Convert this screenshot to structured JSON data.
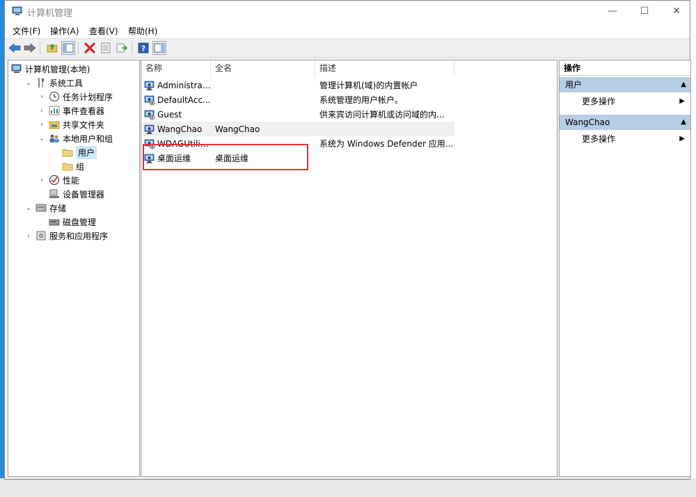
{
  "window": {
    "title": "计算机管理",
    "minimize": "—",
    "maximize": "☐",
    "close": "✕"
  },
  "menu": [
    {
      "label": "文件(F)"
    },
    {
      "label": "操作(A)"
    },
    {
      "label": "查看(V)"
    },
    {
      "label": "帮助(H)"
    }
  ],
  "toolbar": [
    {
      "icon": "back-arrow-icon"
    },
    {
      "icon": "forward-arrow-icon"
    },
    {
      "icon": "up-folder-icon"
    },
    {
      "icon": "show-hide-tree-icon"
    },
    {
      "icon": "delete-icon"
    },
    {
      "icon": "properties-icon"
    },
    {
      "icon": "export-list-icon"
    },
    {
      "icon": "help-icon"
    },
    {
      "icon": "show-hide-action-pane-icon"
    }
  ],
  "tree": [
    {
      "label": "计算机管理(本地)",
      "indent": 0,
      "chevron": "",
      "icon": "computer-icon"
    },
    {
      "label": "系统工具",
      "indent": 1,
      "chevron": "⌄",
      "icon": "tools-icon"
    },
    {
      "label": "任务计划程序",
      "indent": 2,
      "chevron": "›",
      "icon": "clock-icon"
    },
    {
      "label": "事件查看器",
      "indent": 2,
      "chevron": "›",
      "icon": "event-viewer-icon"
    },
    {
      "label": "共享文件夹",
      "indent": 2,
      "chevron": "›",
      "icon": "shared-folder-icon"
    },
    {
      "label": "本地用户和组",
      "indent": 2,
      "chevron": "⌄",
      "icon": "users-group-icon"
    },
    {
      "label": "用户",
      "indent": 3,
      "chevron": "",
      "icon": "folder-icon",
      "selected": true
    },
    {
      "label": "组",
      "indent": 3,
      "chevron": "",
      "icon": "folder-icon"
    },
    {
      "label": "性能",
      "indent": 2,
      "chevron": "›",
      "icon": "performance-icon"
    },
    {
      "label": "设备管理器",
      "indent": 2,
      "chevron": "",
      "icon": "device-manager-icon"
    },
    {
      "label": "存储",
      "indent": 1,
      "chevron": "⌄",
      "icon": "storage-icon"
    },
    {
      "label": "磁盘管理",
      "indent": 2,
      "chevron": "",
      "icon": "disk-icon"
    },
    {
      "label": "服务和应用程序",
      "indent": 1,
      "chevron": "›",
      "icon": "services-icon"
    }
  ],
  "columns": {
    "name": "名称",
    "fullname": "全名",
    "desc": "描述"
  },
  "users": [
    {
      "name": "Administrat...",
      "fullname": "",
      "desc": "管理计算机(域)的内置帐户"
    },
    {
      "name": "DefaultAcc...",
      "fullname": "",
      "desc": "系统管理的用户帐户。"
    },
    {
      "name": "Guest",
      "fullname": "",
      "desc": "供来宾访问计算机或访问域的内..."
    },
    {
      "name": "WangChao",
      "fullname": "WangChao",
      "desc": "",
      "highlight": true
    },
    {
      "name": "WDAGUtilit...",
      "fullname": "",
      "desc": "系统为 Windows Defender 应用..."
    },
    {
      "name": "桌面运维",
      "fullname": "桌面运维",
      "desc": ""
    }
  ],
  "actions": {
    "title": "操作",
    "groups": [
      {
        "label": "用户",
        "item": "更多操作"
      },
      {
        "label": "WangChao",
        "item": "更多操作"
      }
    ]
  }
}
